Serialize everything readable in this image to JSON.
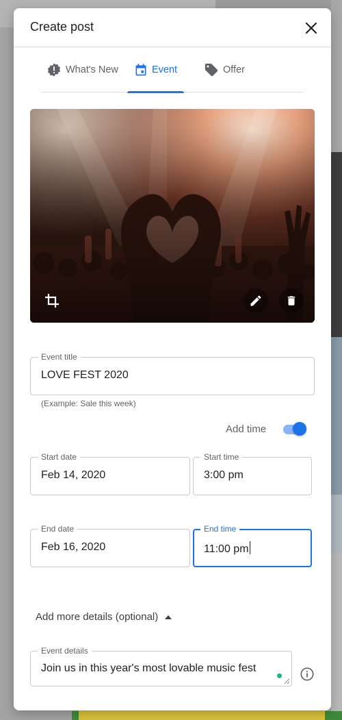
{
  "dialog": {
    "title": "Create post",
    "close_icon": "close-icon"
  },
  "tabs": [
    {
      "label": "What's New",
      "icon": "whats-new-badge-icon",
      "active": false
    },
    {
      "label": "Event",
      "icon": "calendar-icon",
      "active": true
    },
    {
      "label": "Offer",
      "icon": "tag-icon",
      "active": false
    }
  ],
  "photo": {
    "actions": [
      "crop-icon",
      "edit-pencil-icon",
      "delete-trash-icon"
    ]
  },
  "form": {
    "event_title": {
      "label": "Event title",
      "value": "LOVE FEST 2020",
      "helper": "(Example: Sale this week)"
    },
    "add_time": {
      "label": "Add time",
      "enabled": true
    },
    "start_date": {
      "label": "Start date",
      "value": "Feb 14, 2020"
    },
    "start_time": {
      "label": "Start time",
      "value": "3:00 pm"
    },
    "end_date": {
      "label": "End date",
      "value": "Feb 16, 2020"
    },
    "end_time": {
      "label": "End time",
      "value": "11:00 pm",
      "focused": true
    },
    "more_details": {
      "label": "Add more details (optional)",
      "expanded": true
    },
    "event_details": {
      "label": "Event details",
      "value": "Join us in this year's most lovable music fest"
    }
  },
  "colors": {
    "accent": "#1a73e8",
    "toggle_track": "#8ab4f8",
    "text_secondary": "#5f6368"
  }
}
